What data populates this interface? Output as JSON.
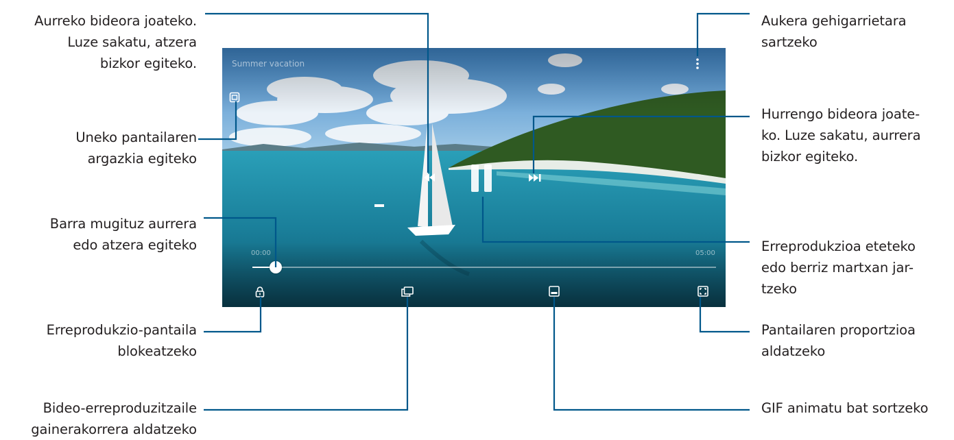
{
  "player": {
    "title": "Summer vacation",
    "time_elapsed": "00:00",
    "time_total": "05:00",
    "progress_fraction": 0.05,
    "accent": "#ffffff"
  },
  "icons": {
    "capture": "screenshot-icon",
    "more": "more-options-icon",
    "rewind": "rewind-icon",
    "pause": "pause-icon",
    "forward": "fast-forward-icon",
    "lock": "lock-icon",
    "popup": "popup-player-icon",
    "gif": "gif-icon",
    "ratio": "screen-ratio-icon"
  },
  "callouts": {
    "prev_video": [
      "Aurreko bideora joateko.",
      "Luze sakatu, atzera",
      "bizkor egiteko."
    ],
    "capture": [
      "Uneko pantailaren",
      "argazkia egiteko"
    ],
    "seek": [
      "Barra mugituz aurrera",
      "edo atzera egiteko"
    ],
    "lock": [
      "Erreprodukzio-pantaila",
      "blokeatzeko"
    ],
    "popup": [
      "Bideo-erreproduzitzaile",
      "gainerakorrera aldatzeko"
    ],
    "more": [
      "Aukera gehigarrietara",
      "sartzeko"
    ],
    "next_video": [
      "Hurrengo bideora joate-",
      "ko. Luze sakatu, aurrera",
      "bizkor egiteko."
    ],
    "pause": [
      "Erreprodukzioa eteteko",
      "edo berriz martxan jar-",
      "tzeko"
    ],
    "ratio": [
      "Pantailaren proportzioa",
      "aldatzeko"
    ],
    "gif": [
      "GIF animatu bat sortzeko"
    ]
  }
}
